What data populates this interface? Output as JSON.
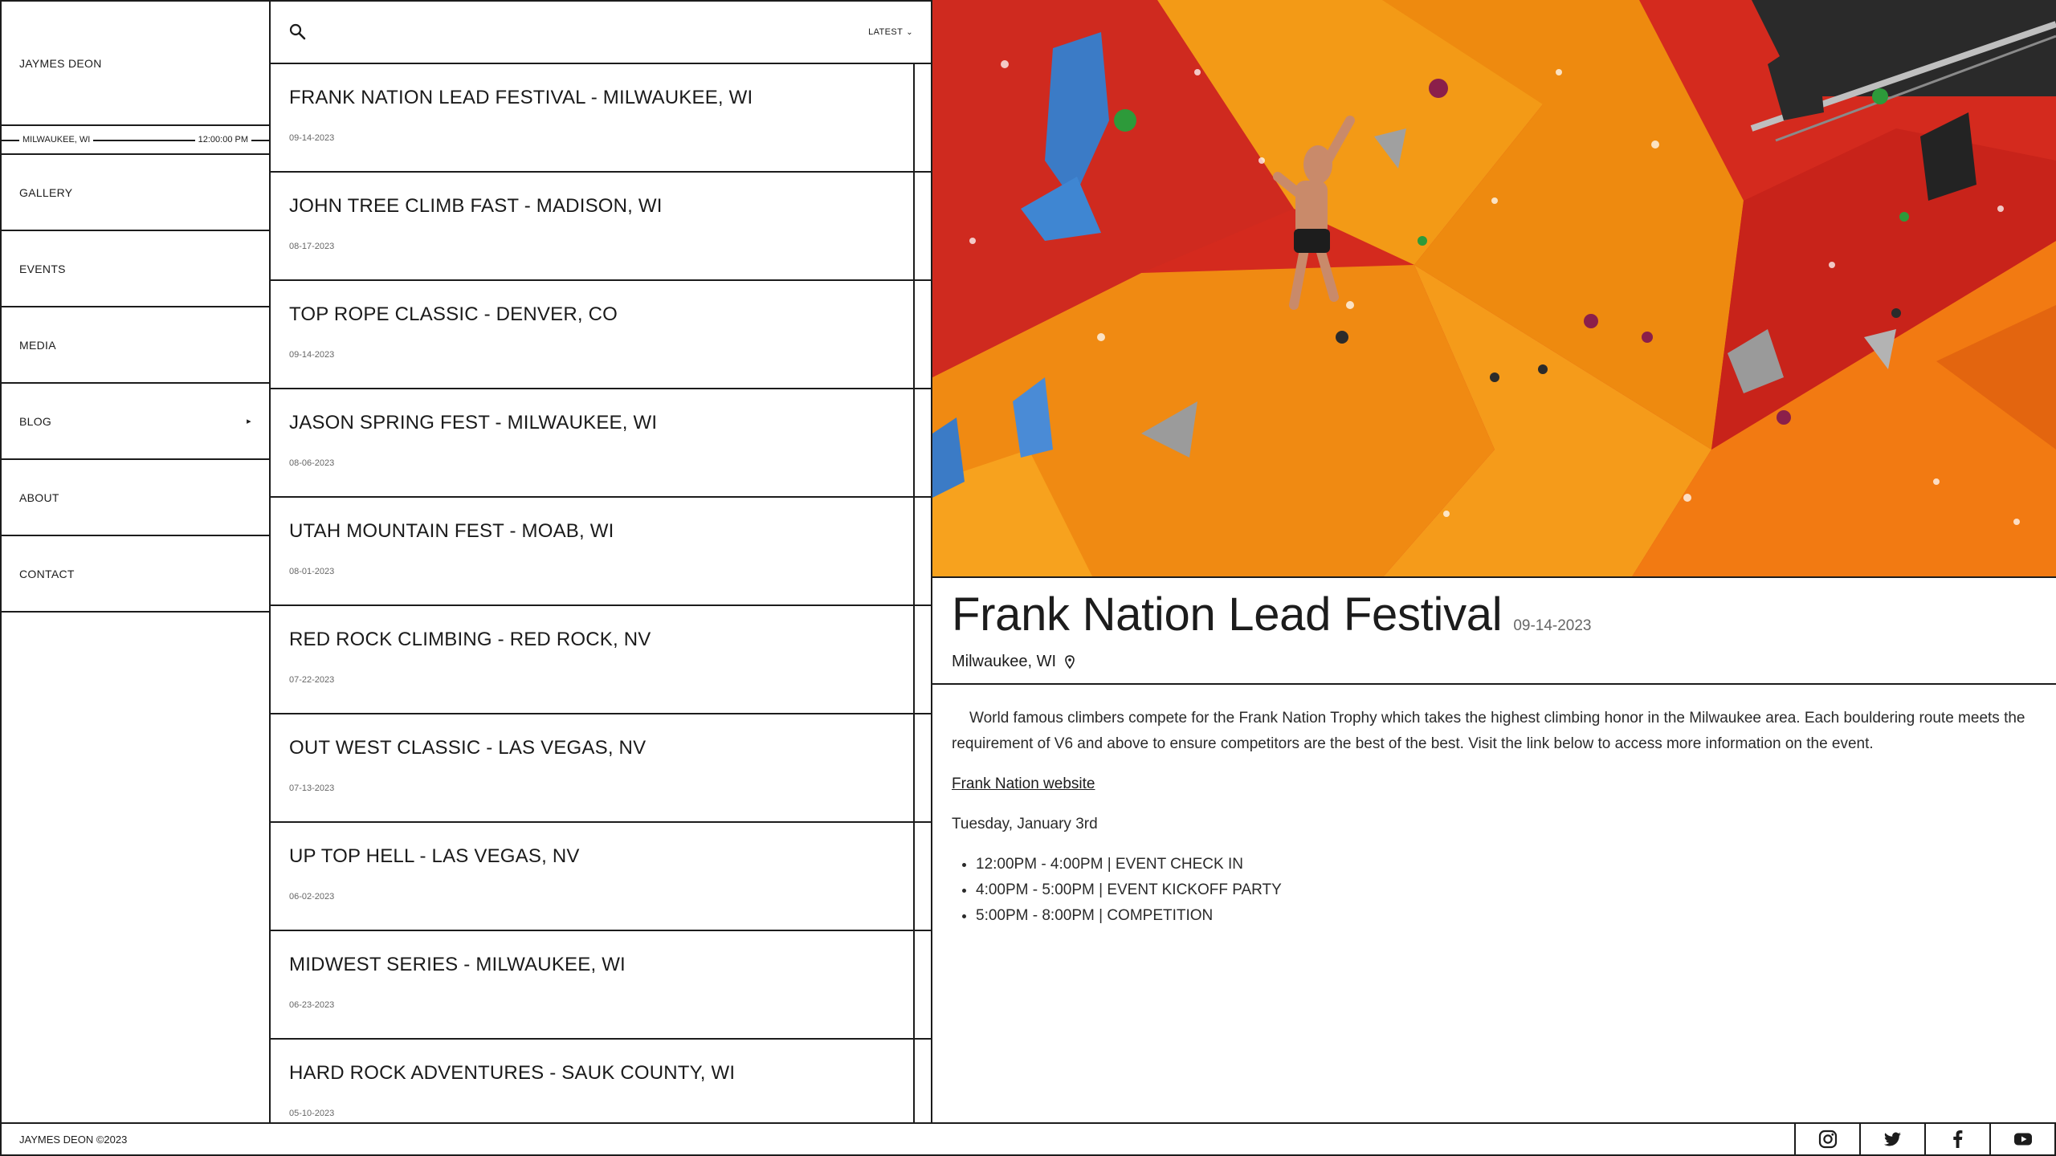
{
  "sidebar": {
    "brand": "JAYMES DEON",
    "location": "MILWAUKEE, WI",
    "time": "12:00:00 PM",
    "items": [
      {
        "label": "GALLERY"
      },
      {
        "label": "EVENTS"
      },
      {
        "label": "MEDIA"
      },
      {
        "label": "BLOG",
        "arrow": "▸"
      },
      {
        "label": "ABOUT"
      },
      {
        "label": "CONTACT"
      }
    ]
  },
  "list": {
    "sort_label": "LATEST",
    "sort_icon": "chevron-down-icon",
    "events": [
      {
        "title": "FRANK NATION LEAD FESTIVAL - MILWAUKEE, WI",
        "date": "09-14-2023"
      },
      {
        "title": "JOHN TREE CLIMB FAST - MADISON, WI",
        "date": "08-17-2023"
      },
      {
        "title": "TOP ROPE CLASSIC - DENVER, CO",
        "date": "09-14-2023"
      },
      {
        "title": "JASON SPRING FEST - MILWAUKEE, WI",
        "date": "08-06-2023"
      },
      {
        "title": "UTAH MOUNTAIN FEST - MOAB, WI",
        "date": "08-01-2023"
      },
      {
        "title": "RED ROCK CLIMBING - RED ROCK, NV",
        "date": "07-22-2023"
      },
      {
        "title": "OUT WEST CLASSIC - LAS VEGAS, NV",
        "date": "07-13-2023"
      },
      {
        "title": "UP TOP HELL - LAS VEGAS, NV",
        "date": "06-02-2023"
      },
      {
        "title": "MIDWEST SERIES - MILWAUKEE, WI",
        "date": "06-23-2023"
      },
      {
        "title": "HARD ROCK ADVENTURES - SAUK COUNTY, WI",
        "date": "05-10-2023"
      }
    ]
  },
  "detail": {
    "title": "Frank Nation Lead Festival",
    "date": "09-14-2023",
    "location": "Milwaukee, WI",
    "description": "World famous climbers compete for the Frank Nation Trophy which takes the highest climbing honor in the Milwaukee area. Each bouldering route meets the requirement of V6 and above to ensure competitors are the best of the best. Visit the link below to access more information on the event.",
    "link_label": "Frank Nation website",
    "day": "Tuesday, January 3rd",
    "schedule": [
      "12:00PM - 4:00PM | EVENT CHECK IN",
      "4:00PM - 5:00PM | EVENT KICKOFF PARTY",
      "5:00PM - 8:00PM | COMPETITION"
    ],
    "colors": {
      "wall_red": "#d42a1e",
      "wall_orange": "#f08a12",
      "hold_blue": "#3b7bc6"
    }
  },
  "footer": {
    "copyright": "JAYMES DEON ©2023",
    "social": [
      "instagram-icon",
      "twitter-icon",
      "facebook-icon",
      "youtube-icon"
    ]
  }
}
